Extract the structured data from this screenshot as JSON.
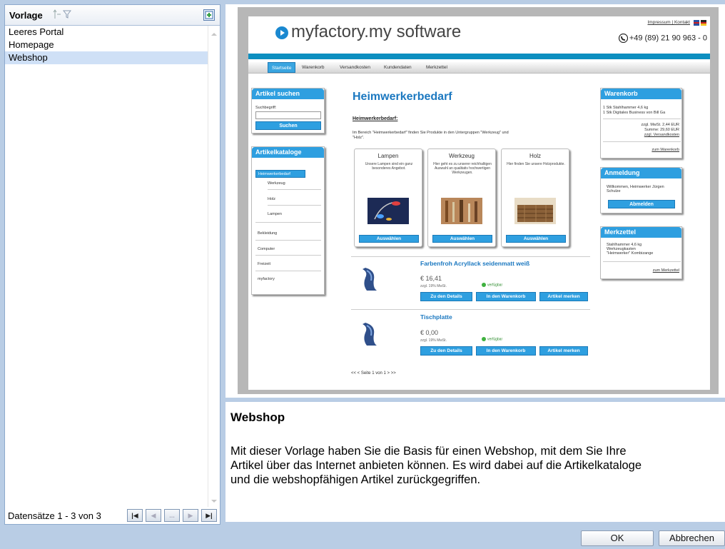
{
  "grid": {
    "column_title": "Vorlage",
    "rows": [
      "Leeres Portal",
      "Homepage",
      "Webshop"
    ],
    "selected_index": 2,
    "record_count": "Datensätze 1 - 3 von 3",
    "pager": {
      "first": "|◀",
      "prev": "◀",
      "more": "...",
      "next": "▶",
      "last": "▶|"
    }
  },
  "preview": {
    "logo_text": "myfactory",
    "logo_suffix": ".my software",
    "top_links": "Impressum | Kontakt",
    "phone": "+49 (89) 21 90 963 - 0",
    "nav": [
      "Startseite",
      "Warenkorb",
      "Versandkosten",
      "Kundendaten",
      "Merkzettel"
    ],
    "search_box": {
      "title": "Artikel suchen",
      "label": "Suchbegriff:",
      "button": "Suchen"
    },
    "catalog_box": {
      "title": "Artikelkataloge",
      "active": "Heimwerkerbedarf",
      "sub": [
        "Werkzeug",
        "Holz",
        "Lampen"
      ],
      "items": [
        "Bekleidung",
        "Computer",
        "Freizeit",
        "myfactory"
      ]
    },
    "heading": "Heimwerkerbedarf",
    "subheading": "Heimwerkerbedarf:",
    "intro": "Im Bereich \"Heimwerkerbedarf\" finden Sie Produkte in den Untergruppen \"Werkzeug\" und \"Holz\".",
    "cards": [
      {
        "title": "Lampen",
        "desc": "Unsere Lampen sind ein ganz besonderes Angebot.",
        "button": "Auswählen"
      },
      {
        "title": "Werkzeug",
        "desc": "Hier geht es zu unserer reichhaltigen Auswahl an qualitativ hochwertigen Werkzeugen.",
        "button": "Auswählen"
      },
      {
        "title": "Holz",
        "desc": "Hier finden Sie unsere Holzprodukte.",
        "button": "Auswählen"
      }
    ],
    "products": [
      {
        "name": "Farbenfroh Acryllack seidenmatt weiß",
        "price": "€ 16,41",
        "tax": "zzgl. 19% MwSt.",
        "availability": "verfügbar",
        "btn_details": "Zu den Details",
        "btn_cart": "In den Warenkorb",
        "btn_remember": "Artikel merken"
      },
      {
        "name": "Tischplatte",
        "price": "€ 0,00",
        "tax": "zzgl. 19% MwSt.",
        "availability": "verfügbar",
        "btn_details": "Zu den Details",
        "btn_cart": "In den Warenkorb",
        "btn_remember": "Artikel merken"
      }
    ],
    "pagination": "<< < Seite 1 von 1 > >>",
    "cart": {
      "title": "Warenkorb",
      "line1": "1 Stk Stahlhammer 4,6 kg",
      "line2": "1 Stk Digitales Business von Bill Ga",
      "tax": "zzgl. MwSt. 2,44 EUR",
      "sum": "Summe: 29,60 EUR",
      "shipping": "zzgl. Versandkosten",
      "link": "zum Warenkorb"
    },
    "login": {
      "title": "Anmeldung",
      "text": "Willkommen, Heimwerker Jürgen Schulze",
      "button": "Abmelden"
    },
    "memo": {
      "title": "Merkzettel",
      "text": "Stahlhammer 4,6 kg Werkzeugkasten \"Heimwerker\" Kombizange",
      "link": "zum Merkzettel"
    }
  },
  "description": {
    "title": "Webshop",
    "lines": [
      "Mit dieser Vorlage haben Sie die Basis für einen Webshop, mit dem Sie Ihre",
      "Artikel über das Internet anbieten können. Es wird dabei auf die Artikelkataloge",
      "und die webshopfähigen Artikel zurückgegriffen."
    ]
  },
  "buttons": {
    "ok": "OK",
    "cancel": "Abbrechen"
  },
  "colors": {
    "accent": "#2e9fe0",
    "background": "#b9cde5",
    "selection": "#cfe0f6",
    "heading_blue": "#1b78c0"
  }
}
